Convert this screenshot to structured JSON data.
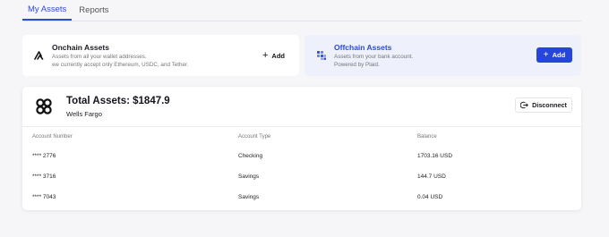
{
  "tabs": [
    {
      "label": "My Assets",
      "active": true
    },
    {
      "label": "Reports",
      "active": false
    }
  ],
  "onchain": {
    "title": "Onchain Assets",
    "desc_line1": "Assets from all your wallet addresses.",
    "desc_line2": "we currently accept only Ethereum, USDC, and Tether.",
    "add_label": "Add",
    "icon": "wallet-chevron-icon"
  },
  "offchain": {
    "title": "Offchain Assets",
    "desc_line1": "Assets from your bank account.",
    "desc_line2": "Powered by Plaid.",
    "add_label": "Add",
    "icon": "plaid-icon",
    "accent": "#2646db"
  },
  "bank": {
    "total": "Total Assets: $1847.9",
    "name": "Wells Fargo",
    "disconnect_label": "Disconnect",
    "columns": [
      "Account Number",
      "Account Type",
      "Balance"
    ],
    "rows": [
      {
        "number": "**** 2776",
        "type": "Checking",
        "balance": "1703.16 USD"
      },
      {
        "number": "**** 3716",
        "type": "Savings",
        "balance": "144.7 USD"
      },
      {
        "number": "**** 7043",
        "type": "Savings",
        "balance": "0.04 USD"
      }
    ]
  }
}
